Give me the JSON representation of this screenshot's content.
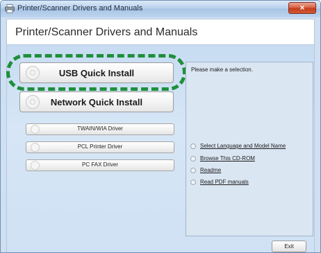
{
  "window": {
    "title": "Printer/Scanner Drivers and Manuals",
    "close_label": "×"
  },
  "header": {
    "title": "Printer/Scanner Drivers and Manuals"
  },
  "left": {
    "main_buttons": [
      {
        "label": "USB Quick Install",
        "icon": "cd-icon"
      },
      {
        "label": "Network Quick Install",
        "icon": "cd-icon"
      }
    ],
    "driver_buttons": [
      {
        "label": "TWAIN/WIA Driver",
        "icon": "cd-icon"
      },
      {
        "label": "PCL Printer Driver",
        "icon": "cd-icon"
      },
      {
        "label": "PC FAX Driver",
        "icon": "cd-icon"
      }
    ]
  },
  "right": {
    "prompt": "Please make a selection.",
    "options": [
      {
        "label": "Select Language and Model Name"
      },
      {
        "label": "Browse This CD-ROM"
      },
      {
        "label": "Readme"
      },
      {
        "label": "Read PDF manuals"
      }
    ]
  },
  "footer": {
    "exit_label": "Exit"
  },
  "colors": {
    "highlight": "#1f8f3a",
    "close_button": "#c43b1b",
    "panel_background": "#cfe1f4"
  }
}
